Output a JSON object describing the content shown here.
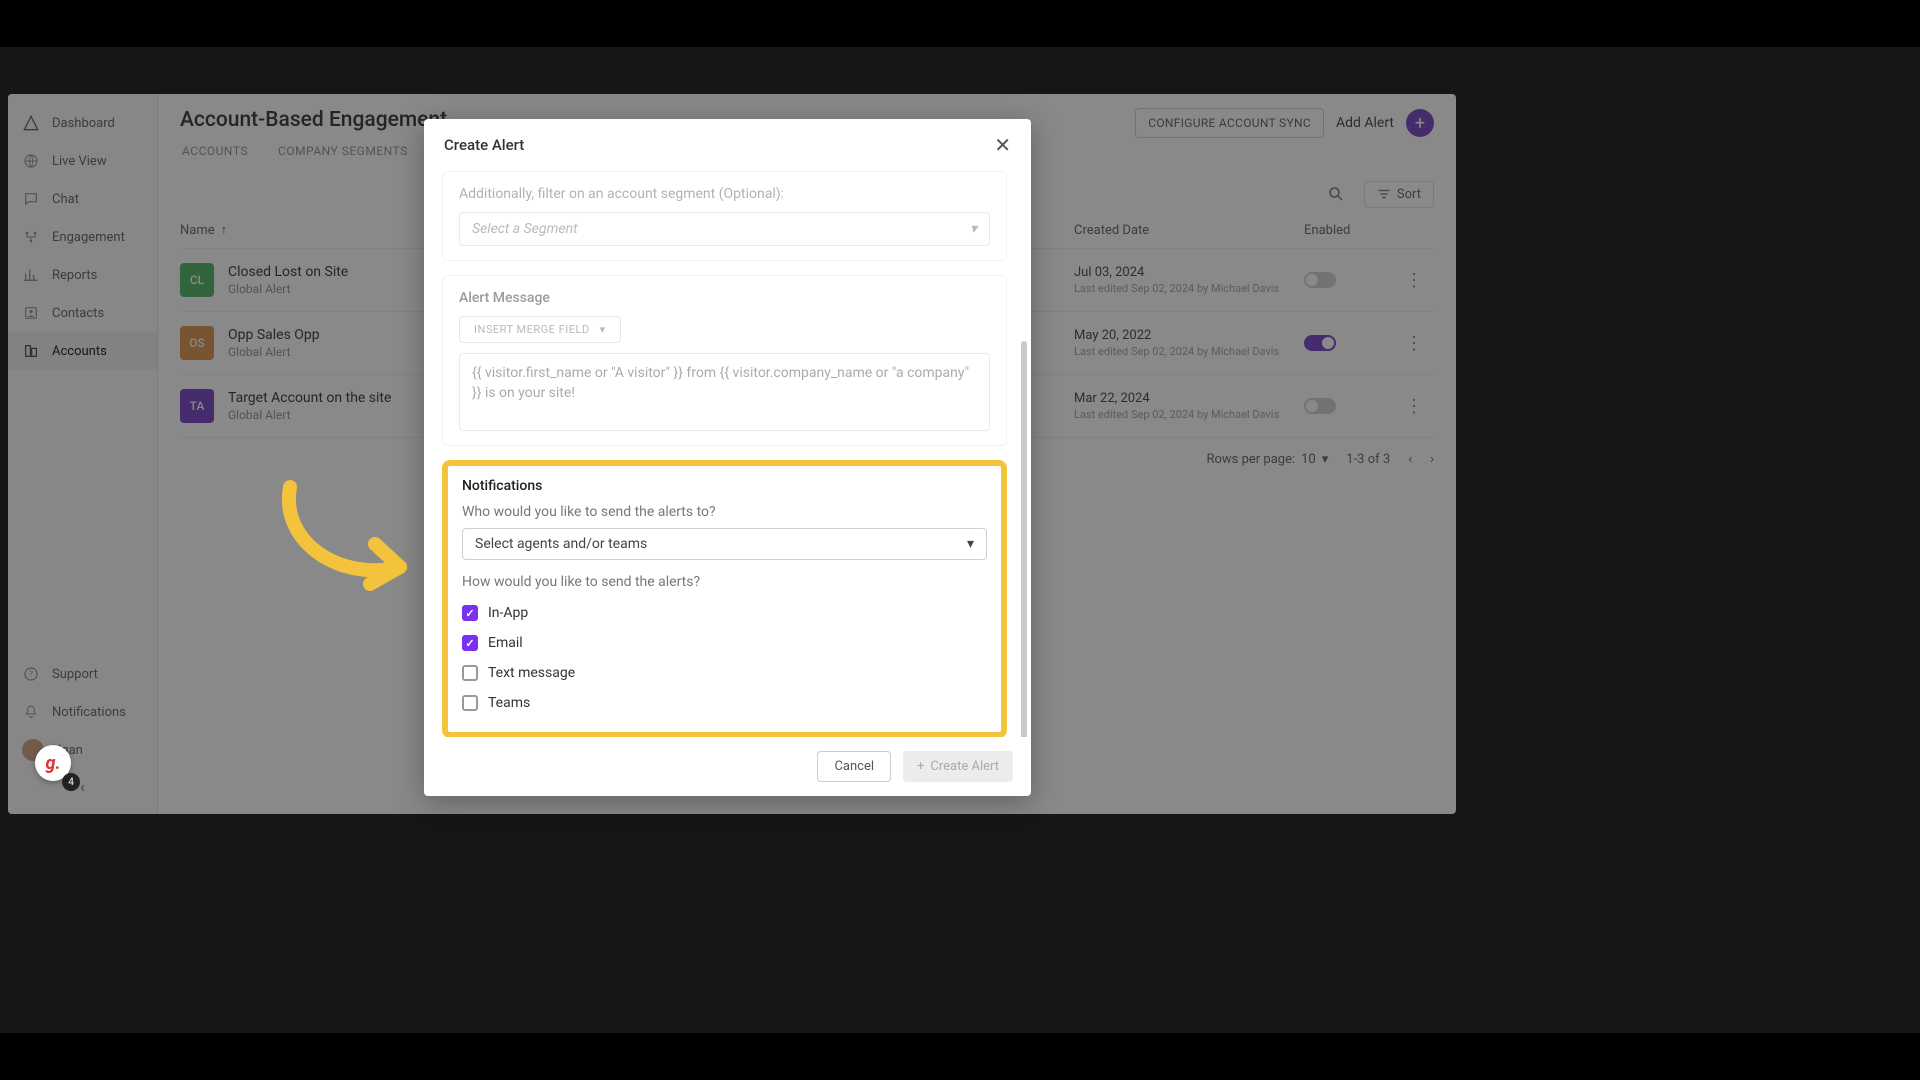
{
  "sidebar": {
    "items": [
      {
        "label": "Dashboard"
      },
      {
        "label": "Live View"
      },
      {
        "label": "Chat"
      },
      {
        "label": "Engagement"
      },
      {
        "label": "Reports"
      },
      {
        "label": "Contacts"
      },
      {
        "label": "Accounts"
      }
    ],
    "support": "Support",
    "notifications": "Notifications",
    "user_name": "Ngan"
  },
  "header": {
    "title": "Account-Based Engagement",
    "tabs": [
      "ACCOUNTS",
      "COMPANY SEGMENTS"
    ],
    "configure": "CONFIGURE ACCOUNT SYNC",
    "add_alert": "Add Alert"
  },
  "toolbar": {
    "sort": "Sort"
  },
  "columns": {
    "name": "Name",
    "created": "Created Date",
    "enabled": "Enabled"
  },
  "rows": [
    {
      "initials": "CL",
      "color": "#3fae5a",
      "title": "Closed Lost on Site",
      "sub": "Global Alert",
      "date": "Jul 03, 2024",
      "edited": "Last edited Sep 02, 2024 by Michael Davis",
      "on": false
    },
    {
      "initials": "OS",
      "color": "#d9893a",
      "title": "Opp Sales Opp",
      "sub": "Global Alert",
      "date": "May 20, 2022",
      "edited": "Last edited Sep 02, 2024 by Michael Davis",
      "on": true
    },
    {
      "initials": "TA",
      "color": "#6a2fc2",
      "title": "Target Account on the site",
      "sub": "Global Alert",
      "date": "Mar 22, 2024",
      "edited": "Last edited Sep 02, 2024 by Michael Davis",
      "on": false
    }
  ],
  "pager": {
    "rpp_label": "Rows per page:",
    "rpp_value": "10",
    "range": "1-3 of 3"
  },
  "modal": {
    "title": "Create Alert",
    "filter_label": "Additionally, filter on an account segment (Optional):",
    "segment_placeholder": "Select a Segment",
    "message_label": "Alert Message",
    "merge_btn": "INSERT MERGE FIELD",
    "message_text": "{{ visitor.first_name or \"A visitor\" }} from {{ visitor.company_name or \"a company\" }} is on your site!",
    "notif_title": "Notifications",
    "notif_who": "Who would you like to send the alerts to?",
    "notif_agents_placeholder": "Select agents and/or teams",
    "notif_how": "How would you like to send the alerts?",
    "channels": [
      {
        "label": "In-App",
        "checked": true
      },
      {
        "label": "Email",
        "checked": true
      },
      {
        "label": "Text message",
        "checked": false
      },
      {
        "label": "Teams",
        "checked": false
      }
    ],
    "cancel": "Cancel",
    "create": "Create Alert"
  },
  "badge": {
    "g": "g.",
    "count": "4"
  }
}
